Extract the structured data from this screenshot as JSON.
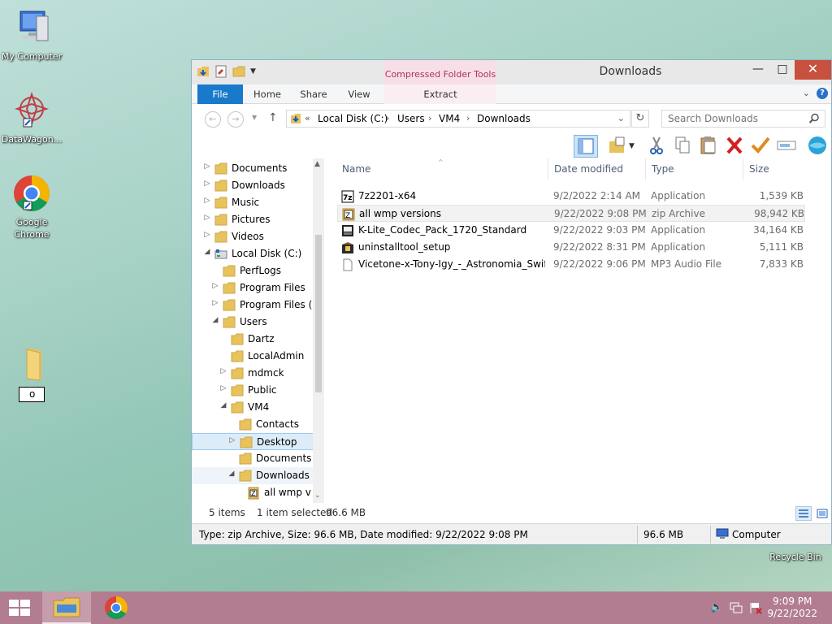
{
  "desktop": {
    "icons": [
      {
        "label": "My Computer",
        "icon": "my-computer-icon"
      },
      {
        "label": "DataWagon...",
        "icon": "datawagon-icon"
      },
      {
        "label": "Google Chrome",
        "icon": "chrome-icon"
      },
      {
        "label": "o",
        "icon": "folder-icon"
      },
      {
        "label": "Recycle Bin",
        "icon": "recycle-bin-icon"
      }
    ]
  },
  "window": {
    "title": "Downloads",
    "context_tab": "Compressed Folder Tools",
    "ribbon_tabs": [
      "File",
      "Home",
      "Share",
      "View"
    ],
    "extract_tab": "Extract",
    "breadcrumb": {
      "overflow": "«",
      "items": [
        "Local Disk (C:)",
        "Users",
        "VM4",
        "Downloads"
      ]
    },
    "search_placeholder": "Search Downloads",
    "accent": "#1979ca"
  },
  "nav_tree": [
    {
      "label": "Documents",
      "expander": "▷",
      "icon": "documents-folder-icon"
    },
    {
      "label": "Downloads",
      "expander": "▷",
      "icon": "downloads-folder-icon"
    },
    {
      "label": "Music",
      "expander": "▷",
      "icon": "music-folder-icon"
    },
    {
      "label": "Pictures",
      "expander": "▷",
      "icon": "pictures-folder-icon"
    },
    {
      "label": "Videos",
      "expander": "▷",
      "icon": "videos-folder-icon"
    },
    {
      "label": "Local Disk (C:)",
      "expander": "◢",
      "icon": "drive-icon"
    },
    {
      "label": "PerfLogs",
      "expander": "",
      "icon": "folder-icon"
    },
    {
      "label": "Program Files",
      "expander": "▷",
      "icon": "folder-icon"
    },
    {
      "label": "Program Files (",
      "expander": "▷",
      "icon": "folder-icon"
    },
    {
      "label": "Users",
      "expander": "◢",
      "icon": "folder-icon"
    },
    {
      "label": "Dartz",
      "expander": "",
      "icon": "folder-icon"
    },
    {
      "label": "LocalAdmin",
      "expander": "",
      "icon": "folder-icon"
    },
    {
      "label": "mdmck",
      "expander": "▷",
      "icon": "folder-icon"
    },
    {
      "label": "Public",
      "expander": "▷",
      "icon": "folder-icon"
    },
    {
      "label": "VM4",
      "expander": "◢",
      "icon": "folder-icon"
    },
    {
      "label": "Contacts",
      "expander": "",
      "icon": "contacts-folder-icon"
    },
    {
      "label": "Desktop",
      "expander": "▷",
      "icon": "desktop-folder-icon"
    },
    {
      "label": "Documents",
      "expander": "",
      "icon": "documents-folder-icon"
    },
    {
      "label": "Downloads",
      "expander": "◢",
      "icon": "downloads-folder-icon"
    },
    {
      "label": "all wmp v",
      "expander": "",
      "icon": "zip-icon"
    }
  ],
  "columns": [
    "Name",
    "Date modified",
    "Type",
    "Size"
  ],
  "files": [
    {
      "name": "7z2201-x64",
      "date": "9/2/2022 2:14 AM",
      "type": "Application",
      "size": "1,539 KB",
      "icon": "7zip-icon"
    },
    {
      "name": "all wmp versions",
      "date": "9/22/2022 9:08 PM",
      "type": "zip Archive",
      "size": "98,942 KB",
      "icon": "zip-icon"
    },
    {
      "name": "K-Lite_Codec_Pack_1720_Standard",
      "date": "9/22/2022 9:03 PM",
      "type": "Application",
      "size": "34,164 KB",
      "icon": "klite-icon"
    },
    {
      "name": "uninstalltool_setup",
      "date": "9/22/2022 8:31 PM",
      "type": "Application",
      "size": "5,111 KB",
      "icon": "installer-icon"
    },
    {
      "name": "Vicetone-x-Tony-Igy_-_Astronomia_Swift...",
      "date": "9/22/2022 9:06 PM",
      "type": "MP3 Audio File",
      "size": "7,833 KB",
      "icon": "mp3-file-icon"
    }
  ],
  "status": {
    "items": "5 items",
    "selected": "1 item selected",
    "selected_size": "96.6 MB"
  },
  "details": {
    "text": "Type: zip Archive, Size: 96.6 MB, Date modified: 9/22/2022 9:08 PM",
    "size": "96.6 MB",
    "location": "Computer"
  },
  "taskbar": {
    "time": "9:09 PM",
    "date": "9/22/2022"
  }
}
